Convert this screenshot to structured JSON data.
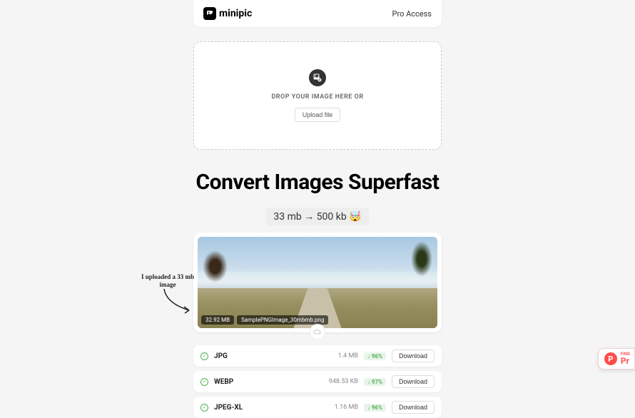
{
  "header": {
    "brand": "minipic",
    "pro_link": "Pro Access"
  },
  "dropzone": {
    "instruction": "DROP YOUR IMAGE HERE OR",
    "upload_button": "Upload file"
  },
  "headline": "Convert Images Superfast",
  "size_comparison": "33 mb → 500 kb 🤯",
  "annotation": "I uploaded a 33 mb image",
  "uploaded_image": {
    "size": "32.92 MB",
    "filename": "SamplePNGImage_30mbmb.png"
  },
  "formats": [
    {
      "name": "JPG",
      "size": "1.4 MB",
      "reduction": "↓ 96%",
      "action": "Download"
    },
    {
      "name": "WEBP",
      "size": "948.53 KB",
      "reduction": "↓ 97%",
      "action": "Download"
    },
    {
      "name": "JPEG-XL",
      "size": "1.16 MB",
      "reduction": "↓ 96%",
      "action": "Download"
    }
  ],
  "floating_badge": {
    "top": "FIND",
    "bottom": "Pr"
  }
}
